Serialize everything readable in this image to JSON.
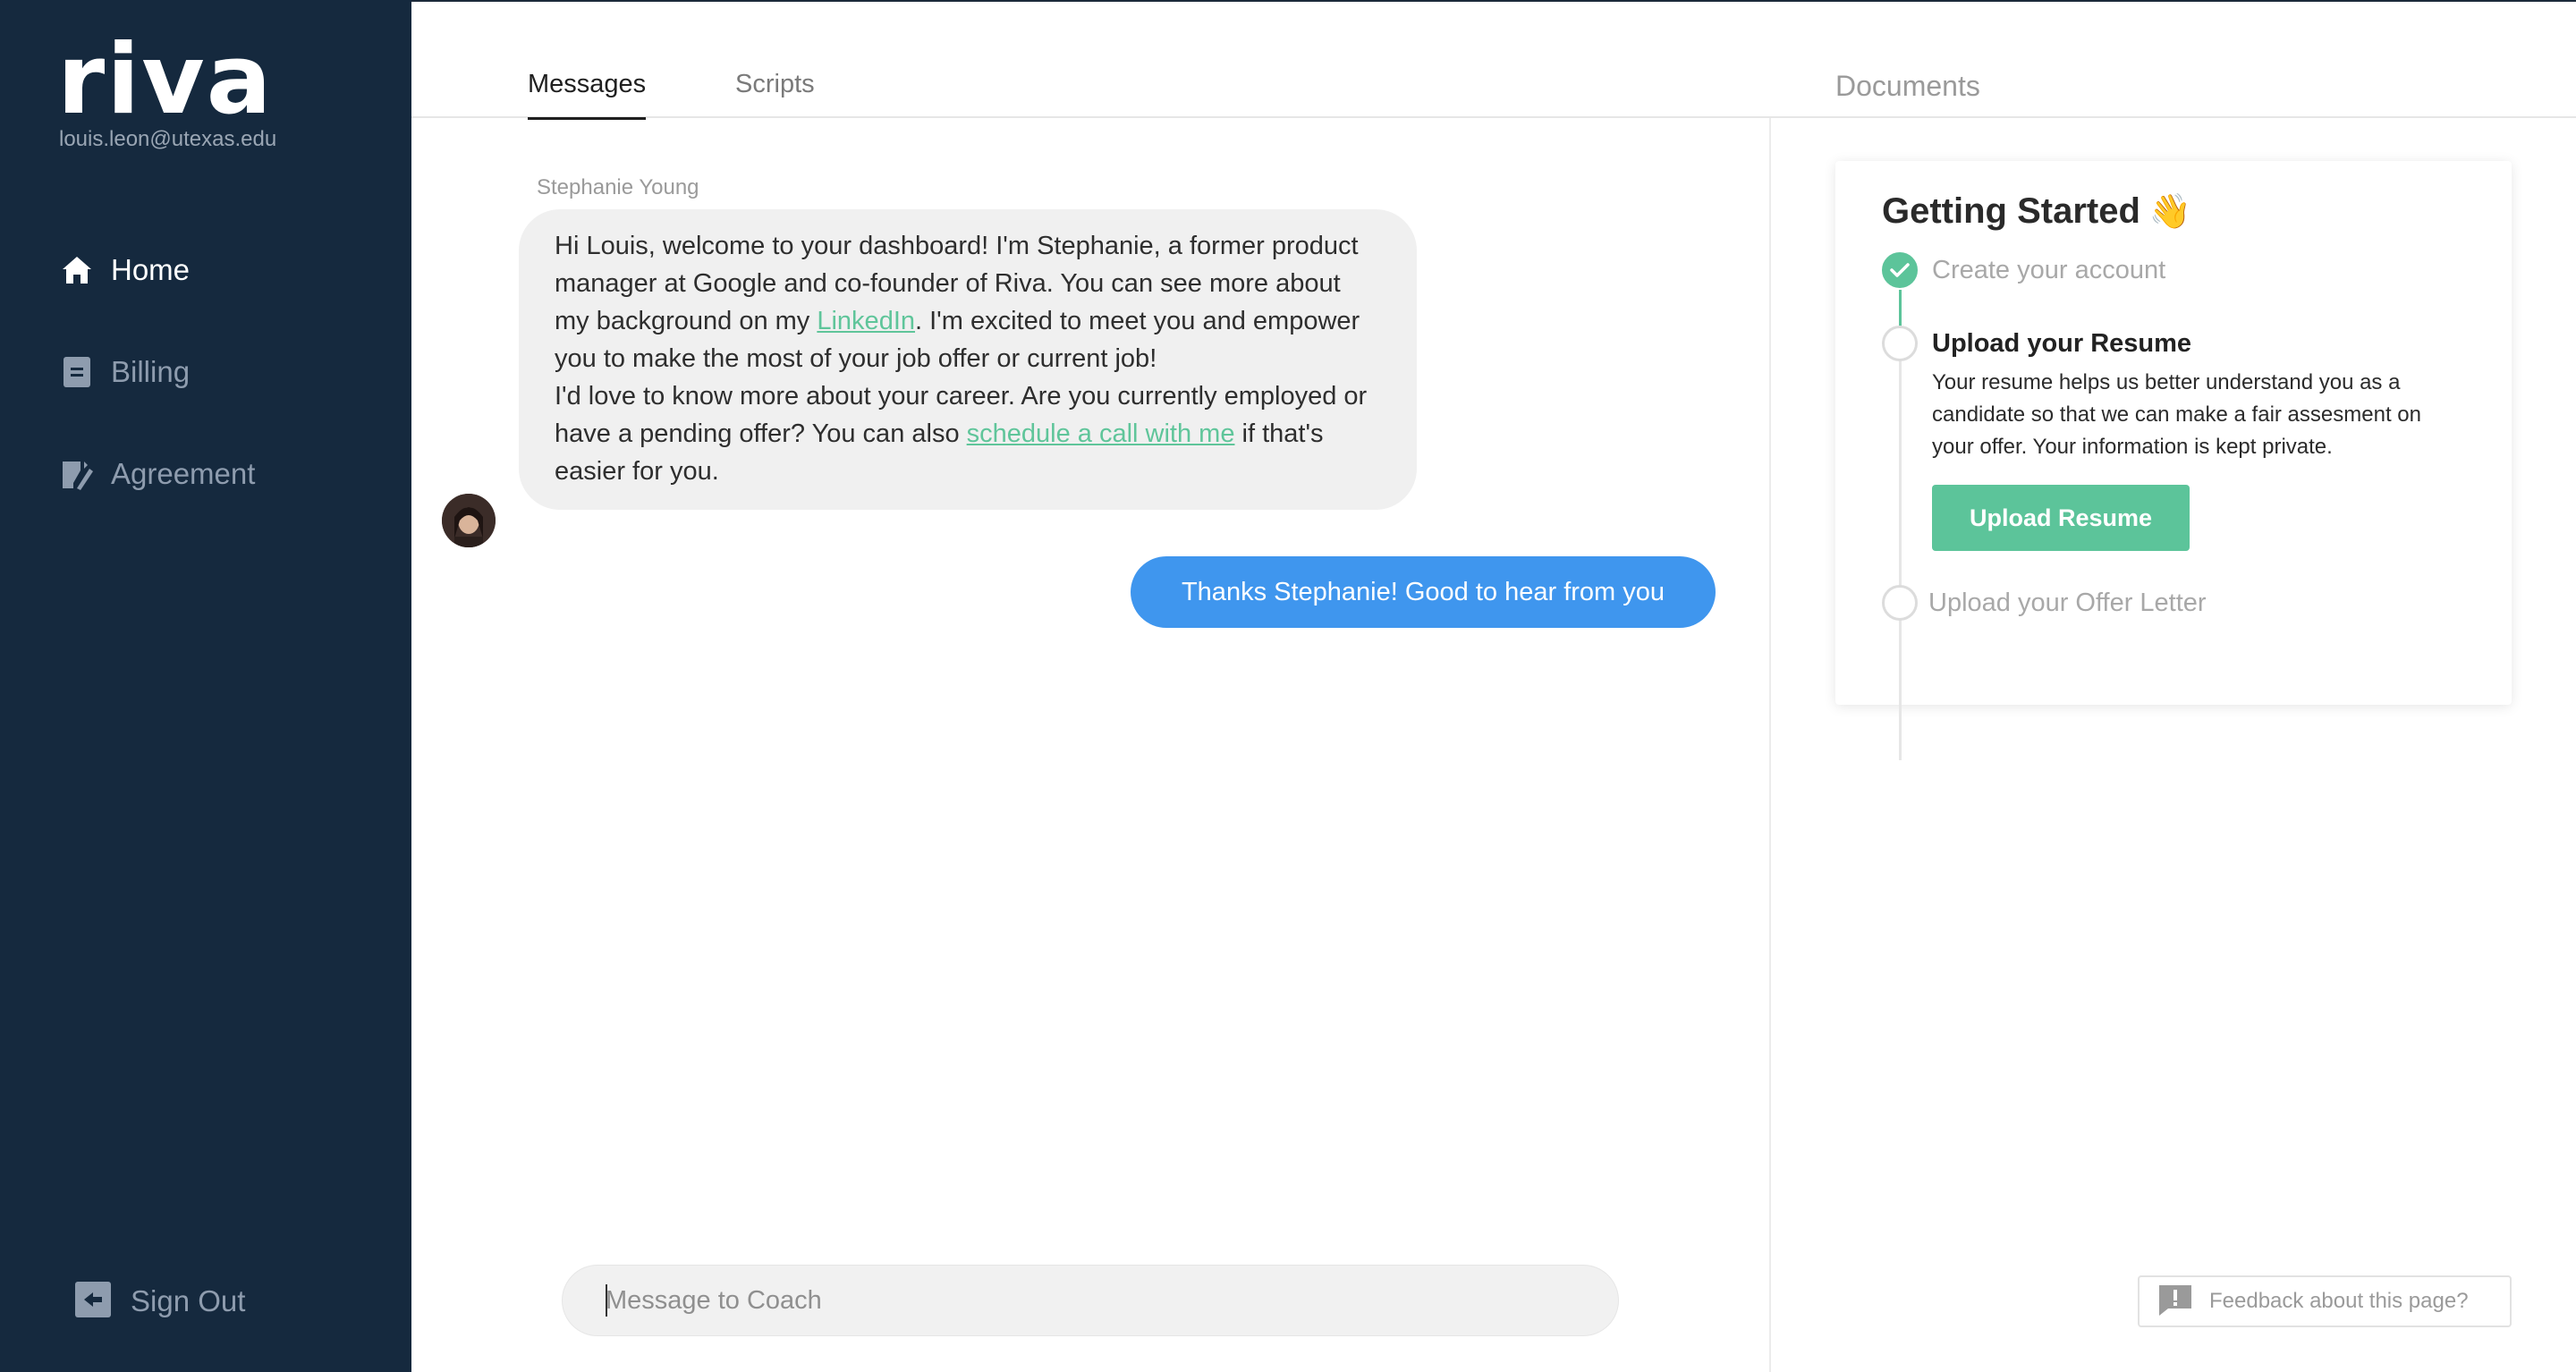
{
  "sidebar": {
    "logo": "riva",
    "email": "louis.leon@utexas.edu",
    "items": [
      {
        "label": "Home",
        "icon": "home-icon"
      },
      {
        "label": "Billing",
        "icon": "billing-icon"
      },
      {
        "label": "Agreement",
        "icon": "agreement-icon"
      }
    ],
    "sign_out": "Sign Out"
  },
  "tabs": [
    {
      "label": "Messages",
      "active": true
    },
    {
      "label": "Scripts",
      "active": false
    }
  ],
  "documents": {
    "title": "Documents",
    "card": {
      "title": "Getting Started",
      "title_emoji": "👋",
      "steps": [
        {
          "title": "Create your account",
          "status": "done"
        },
        {
          "title": "Upload your Resume",
          "status": "current",
          "description": "Your resume helps us better understand you as a candidate so that we can make a fair assesment on your offer. Your information is kept private.",
          "button": "Upload Resume"
        },
        {
          "title": "Upload your Offer Letter",
          "status": "pending"
        }
      ]
    }
  },
  "chat": {
    "sender": "Stephanie Young",
    "incoming": {
      "p1_before": "Hi Louis, welcome to your dashboard! I'm Stephanie, a former product manager at Google and co-founder of Riva. You can see more about my background on my ",
      "p1_link": "LinkedIn",
      "p1_after": ". I'm excited to meet you and empower you to make the most of your job offer or cur­rent job!",
      "p2_before": "I'd love to know more about your career. Are you currently em­ployed or have a pending offer? You can also ",
      "p2_link": "schedule a call with me",
      "p2_after": " if that's easier for you."
    },
    "outgoing": "Thanks Stephanie! Good to hear from you",
    "input_placeholder": "Message to Coach"
  },
  "feedback": {
    "label": "Feedback about this page?"
  },
  "colors": {
    "sidebar_bg": "#15293e",
    "accent_green": "#5cc49a",
    "bubble_blue": "#3f96ee",
    "bubble_gray": "#f0f0f0"
  }
}
